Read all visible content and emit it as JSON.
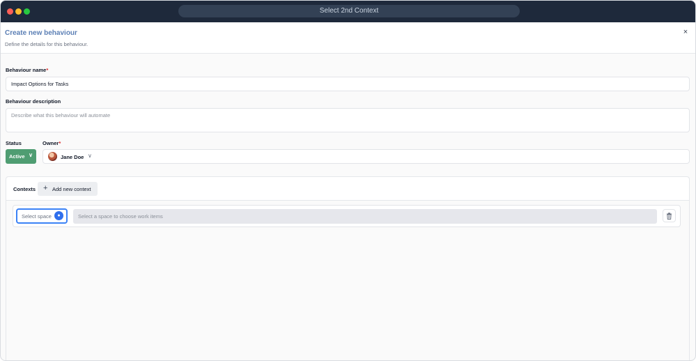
{
  "window": {
    "url_title": "Select 2nd Context"
  },
  "header": {
    "title": "Create new behaviour",
    "subtitle": "Define the details for this behaviour.",
    "close_icon": "×"
  },
  "form": {
    "name_label": "Behaviour name",
    "required_mark": "*",
    "name_value": "Impact Options for Tasks",
    "description_label": "Behaviour description",
    "description_placeholder": "Describe what this behaviour will automate",
    "status_label": "Status",
    "status_value": "Active",
    "owner_label": "Owner",
    "owner_name": "Jane Doe",
    "chevron": "∨"
  },
  "contexts": {
    "label": "Contexts",
    "add_icon": "+",
    "add_button": "Add new context",
    "space_placeholder": "Select space",
    "work_items_placeholder": "Select a space to choose work items"
  },
  "colors": {
    "accent": "#5b7fb5",
    "status_active": "#4f9d72",
    "focus": "#3b82f6",
    "titlebar": "#1e293b"
  },
  "icons": {
    "close": "close-icon",
    "plus": "plus-icon",
    "chevron": "chevron-down-icon",
    "trash": "trash-icon",
    "loading": "loading-spinner-icon",
    "avatar": "avatar"
  }
}
